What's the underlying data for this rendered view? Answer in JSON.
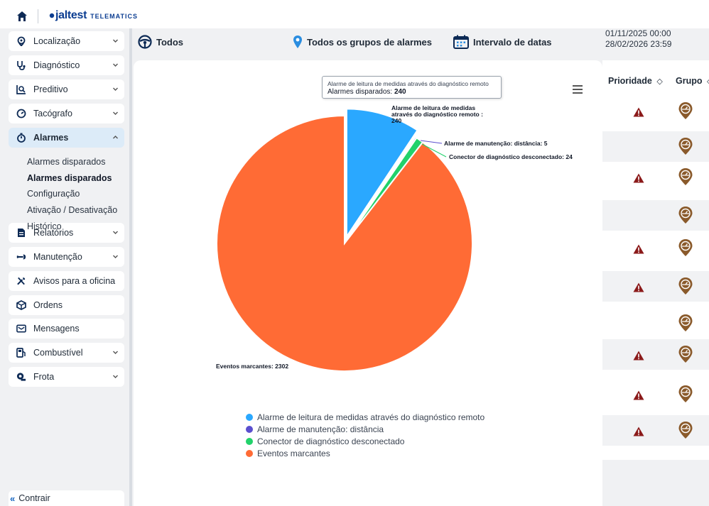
{
  "app": {
    "brand": "jaltest",
    "brand_sub": "TELEMATICS"
  },
  "sidebar": {
    "items": [
      {
        "label": "Localização",
        "icon": "location-icon",
        "has_chevron": true
      },
      {
        "label": "Diagnóstico",
        "icon": "stethoscope-icon",
        "has_chevron": true
      },
      {
        "label": "Preditivo",
        "icon": "chart-analytics-icon",
        "has_chevron": true
      },
      {
        "label": "Tacógrafo",
        "icon": "tachograph-icon",
        "has_chevron": true
      },
      {
        "label": "Alarmes",
        "icon": "stopwatch-icon",
        "has_chevron": true,
        "active": true
      },
      {
        "label": "Relatórios",
        "icon": "document-icon",
        "has_chevron": true
      },
      {
        "label": "Manutenção",
        "icon": "wrench-icon",
        "has_chevron": true
      },
      {
        "label": "Avisos para a oficina",
        "icon": "tools-icon",
        "has_chevron": false
      },
      {
        "label": "Ordens",
        "icon": "box-icon",
        "has_chevron": false
      },
      {
        "label": "Mensagens",
        "icon": "message-icon",
        "has_chevron": false
      },
      {
        "label": "Combustível",
        "icon": "fuel-icon",
        "has_chevron": true
      },
      {
        "label": "Frota",
        "icon": "fleet-icon",
        "has_chevron": true
      }
    ],
    "alarm_subitems": [
      {
        "label": "Alarmes disparados",
        "bold": false
      },
      {
        "label": "Alarmes disparados",
        "bold": true
      },
      {
        "label": "Configuração",
        "bold": false
      },
      {
        "label": "Ativação / Desativação",
        "bold": false
      },
      {
        "label": "Histórico",
        "bold": false
      }
    ],
    "collapse_label": "Contrair"
  },
  "filters": {
    "vehicles": "Todos",
    "alarm_groups": "Todos os grupos de alarmes",
    "date_range_label": "Intervalo de datas",
    "date_from": "01/11/2025 00:00",
    "date_to": "28/02/2026 23:59"
  },
  "tooltip": {
    "title": "Alarme de leitura de medidas através do diagnóstico remoto",
    "value_label": "Alarmes disparados:",
    "value": "240"
  },
  "chart_data": {
    "type": "pie",
    "title": "",
    "slices": [
      {
        "name": "Alarme de leitura de medidas através do diagnóstico remoto",
        "value": 240,
        "color": "#2aa8ff",
        "label_lines": [
          "Alarme de leitura de medidas",
          "através do diagnóstico remoto :",
          "240"
        ],
        "selected": true
      },
      {
        "name": "Alarme de manutenção: distância",
        "value": 5,
        "color": "#5b4fcf",
        "label_lines": [
          "Alarme de manutenção: distância: 5"
        ]
      },
      {
        "name": "Conector de diagnóstico desconectado",
        "value": 24,
        "color": "#22d26b",
        "label_lines": [
          "Conector de diagnóstico desconectado: 24"
        ]
      },
      {
        "name": "Eventos marcantes",
        "value": 2302,
        "color": "#ff6b35",
        "label_lines": [
          "Eventos marcantes: 2302"
        ]
      }
    ],
    "legend_position": "bottom"
  },
  "table": {
    "headers": [
      "Prioridade",
      "Grupo"
    ],
    "rows": [
      {
        "warning": true,
        "shade": false
      },
      {
        "warning": false,
        "shade": true
      },
      {
        "warning": true,
        "shade": false
      },
      {
        "warning": false,
        "shade": true
      },
      {
        "warning": true,
        "shade": false
      },
      {
        "warning": true,
        "shade": true
      },
      {
        "warning": false,
        "shade": false
      },
      {
        "warning": true,
        "shade": true
      },
      {
        "warning": true,
        "shade": false
      },
      {
        "warning": true,
        "shade": true
      }
    ]
  },
  "colors": {
    "accent": "#1565c0",
    "warning": "#8b1a1a",
    "pin": "#8a5a2b"
  }
}
